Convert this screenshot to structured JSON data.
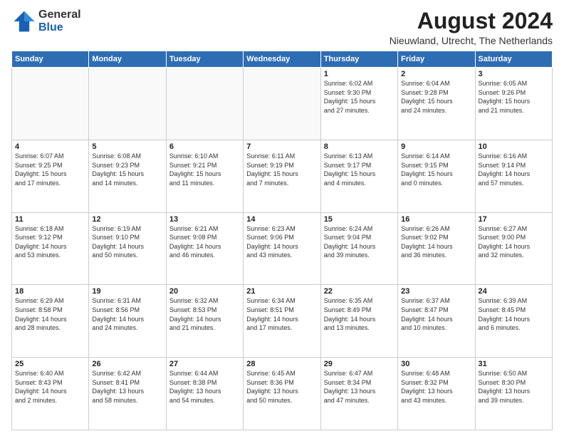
{
  "header": {
    "logo_general": "General",
    "logo_blue": "Blue",
    "main_title": "August 2024",
    "subtitle": "Nieuwland, Utrecht, The Netherlands"
  },
  "calendar": {
    "days_of_week": [
      "Sunday",
      "Monday",
      "Tuesday",
      "Wednesday",
      "Thursday",
      "Friday",
      "Saturday"
    ],
    "weeks": [
      [
        {
          "day": "",
          "info": ""
        },
        {
          "day": "",
          "info": ""
        },
        {
          "day": "",
          "info": ""
        },
        {
          "day": "",
          "info": ""
        },
        {
          "day": "1",
          "info": "Sunrise: 6:02 AM\nSunset: 9:30 PM\nDaylight: 15 hours\nand 27 minutes."
        },
        {
          "day": "2",
          "info": "Sunrise: 6:04 AM\nSunset: 9:28 PM\nDaylight: 15 hours\nand 24 minutes."
        },
        {
          "day": "3",
          "info": "Sunrise: 6:05 AM\nSunset: 9:26 PM\nDaylight: 15 hours\nand 21 minutes."
        }
      ],
      [
        {
          "day": "4",
          "info": "Sunrise: 6:07 AM\nSunset: 9:25 PM\nDaylight: 15 hours\nand 17 minutes."
        },
        {
          "day": "5",
          "info": "Sunrise: 6:08 AM\nSunset: 9:23 PM\nDaylight: 15 hours\nand 14 minutes."
        },
        {
          "day": "6",
          "info": "Sunrise: 6:10 AM\nSunset: 9:21 PM\nDaylight: 15 hours\nand 11 minutes."
        },
        {
          "day": "7",
          "info": "Sunrise: 6:11 AM\nSunset: 9:19 PM\nDaylight: 15 hours\nand 7 minutes."
        },
        {
          "day": "8",
          "info": "Sunrise: 6:13 AM\nSunset: 9:17 PM\nDaylight: 15 hours\nand 4 minutes."
        },
        {
          "day": "9",
          "info": "Sunrise: 6:14 AM\nSunset: 9:15 PM\nDaylight: 15 hours\nand 0 minutes."
        },
        {
          "day": "10",
          "info": "Sunrise: 6:16 AM\nSunset: 9:14 PM\nDaylight: 14 hours\nand 57 minutes."
        }
      ],
      [
        {
          "day": "11",
          "info": "Sunrise: 6:18 AM\nSunset: 9:12 PM\nDaylight: 14 hours\nand 53 minutes."
        },
        {
          "day": "12",
          "info": "Sunrise: 6:19 AM\nSunset: 9:10 PM\nDaylight: 14 hours\nand 50 minutes."
        },
        {
          "day": "13",
          "info": "Sunrise: 6:21 AM\nSunset: 9:08 PM\nDaylight: 14 hours\nand 46 minutes."
        },
        {
          "day": "14",
          "info": "Sunrise: 6:23 AM\nSunset: 9:06 PM\nDaylight: 14 hours\nand 43 minutes."
        },
        {
          "day": "15",
          "info": "Sunrise: 6:24 AM\nSunset: 9:04 PM\nDaylight: 14 hours\nand 39 minutes."
        },
        {
          "day": "16",
          "info": "Sunrise: 6:26 AM\nSunset: 9:02 PM\nDaylight: 14 hours\nand 36 minutes."
        },
        {
          "day": "17",
          "info": "Sunrise: 6:27 AM\nSunset: 9:00 PM\nDaylight: 14 hours\nand 32 minutes."
        }
      ],
      [
        {
          "day": "18",
          "info": "Sunrise: 6:29 AM\nSunset: 8:58 PM\nDaylight: 14 hours\nand 28 minutes."
        },
        {
          "day": "19",
          "info": "Sunrise: 6:31 AM\nSunset: 8:56 PM\nDaylight: 14 hours\nand 24 minutes."
        },
        {
          "day": "20",
          "info": "Sunrise: 6:32 AM\nSunset: 8:53 PM\nDaylight: 14 hours\nand 21 minutes."
        },
        {
          "day": "21",
          "info": "Sunrise: 6:34 AM\nSunset: 8:51 PM\nDaylight: 14 hours\nand 17 minutes."
        },
        {
          "day": "22",
          "info": "Sunrise: 6:35 AM\nSunset: 8:49 PM\nDaylight: 14 hours\nand 13 minutes."
        },
        {
          "day": "23",
          "info": "Sunrise: 6:37 AM\nSunset: 8:47 PM\nDaylight: 14 hours\nand 10 minutes."
        },
        {
          "day": "24",
          "info": "Sunrise: 6:39 AM\nSunset: 8:45 PM\nDaylight: 14 hours\nand 6 minutes."
        }
      ],
      [
        {
          "day": "25",
          "info": "Sunrise: 6:40 AM\nSunset: 8:43 PM\nDaylight: 14 hours\nand 2 minutes."
        },
        {
          "day": "26",
          "info": "Sunrise: 6:42 AM\nSunset: 8:41 PM\nDaylight: 13 hours\nand 58 minutes."
        },
        {
          "day": "27",
          "info": "Sunrise: 6:44 AM\nSunset: 8:38 PM\nDaylight: 13 hours\nand 54 minutes."
        },
        {
          "day": "28",
          "info": "Sunrise: 6:45 AM\nSunset: 8:36 PM\nDaylight: 13 hours\nand 50 minutes."
        },
        {
          "day": "29",
          "info": "Sunrise: 6:47 AM\nSunset: 8:34 PM\nDaylight: 13 hours\nand 47 minutes."
        },
        {
          "day": "30",
          "info": "Sunrise: 6:48 AM\nSunset: 8:32 PM\nDaylight: 13 hours\nand 43 minutes."
        },
        {
          "day": "31",
          "info": "Sunrise: 6:50 AM\nSunset: 8:30 PM\nDaylight: 13 hours\nand 39 minutes."
        }
      ]
    ]
  }
}
